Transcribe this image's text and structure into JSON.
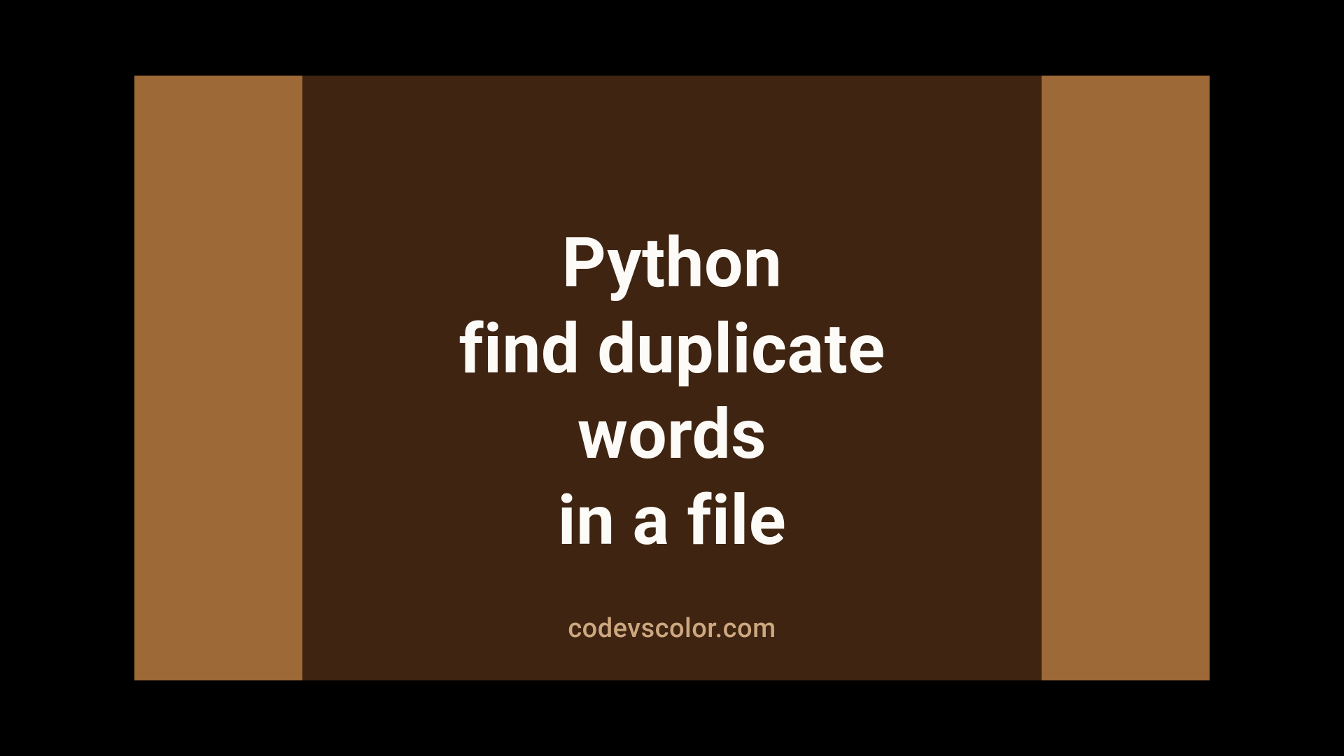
{
  "title": {
    "line1": "Python",
    "line2": "find duplicate",
    "line3": "words",
    "line4": "in a file"
  },
  "site": "codevscolor.com",
  "colors": {
    "outer_bg": "#9d6937",
    "blob_bg": "#3f2412",
    "title_text": "#fdfbf7",
    "site_text": "#cda77f"
  }
}
